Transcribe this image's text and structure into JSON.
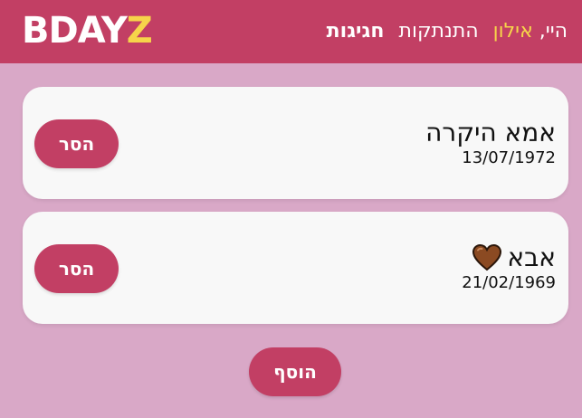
{
  "header": {
    "logo_main": "BDAY",
    "logo_accent": "Z",
    "greeting_prefix": "היי,",
    "user_name": "אילון",
    "logout_label": "התנתקות",
    "nav_active_label": "חגיגות"
  },
  "birthdays": [
    {
      "name": "אמא היקרה",
      "date": "13/07/1972",
      "remove_label": "הסר"
    },
    {
      "name": "אבא",
      "date": "21/02/1969",
      "remove_label": "הסר",
      "icon": "brown-heart-icon"
    }
  ],
  "actions": {
    "add_label": "הוסף"
  },
  "colors": {
    "header_bg": "#c23f64",
    "page_bg": "#d9a8c7",
    "accent_yellow": "#f6d44a",
    "card_bg": "#f8f8f8",
    "heart": "#8b4a22"
  }
}
